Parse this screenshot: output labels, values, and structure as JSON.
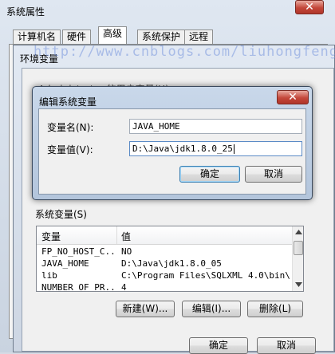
{
  "system_properties": {
    "title": "系统属性",
    "close_glyph": "✕",
    "tabs": [
      "计算机名",
      "硬件",
      "高级",
      "系统保护",
      "远程"
    ],
    "active_tab": 2,
    "ok_label": "确定",
    "cancel_label": "取消"
  },
  "env_vars": {
    "title": "环境变量",
    "user_section_label": "Administrator 的用户变量(U)",
    "system_section_label": "系统变量(S)",
    "columns": [
      "变量",
      "值"
    ],
    "rows": [
      {
        "name": "FP_NO_HOST_C...",
        "value": "NO"
      },
      {
        "name": "JAVA_HOME",
        "value": "D:\\Java\\jdk1.8.0_05"
      },
      {
        "name": "lib",
        "value": "C:\\Program Files\\SQLXML 4.0\\bin\\"
      },
      {
        "name": "NUMBER_OF_PR...",
        "value": "4"
      }
    ],
    "new_label": "新建(W)...",
    "edit_label": "编辑(I)...",
    "delete_label": "删除(L)"
  },
  "watermark": "http://www.cnblogs.com/liuhongfeng",
  "edit_dialog": {
    "title": "编辑系统变量",
    "close_glyph": "✕",
    "name_label": "变量名(N):",
    "value_label": "变量值(V):",
    "name_value": "JAVA_HOME",
    "value_value": "D:\\Java\\jdk1.8.0_25",
    "ok_label": "确定",
    "cancel_label": "取消"
  }
}
